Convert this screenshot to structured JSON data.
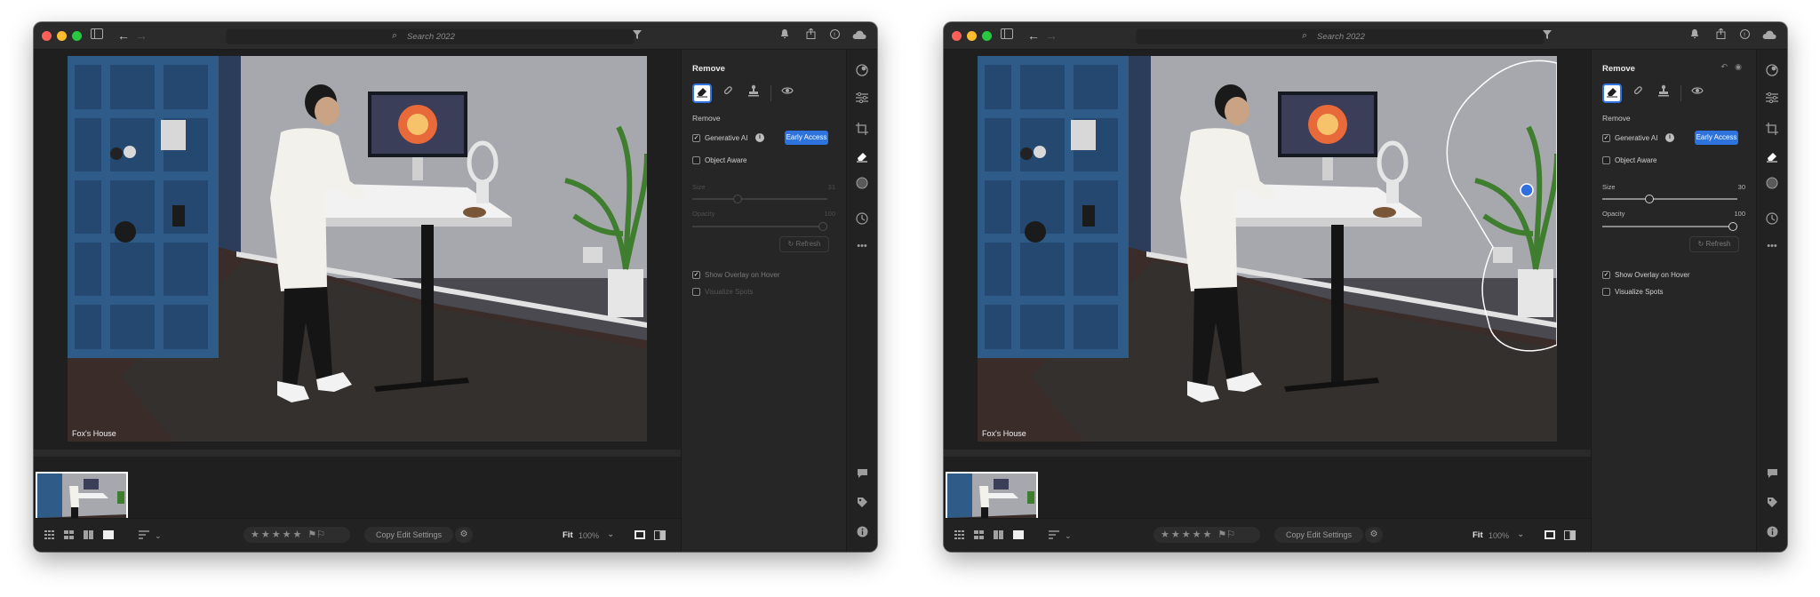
{
  "windows": [
    {
      "search_placeholder": "Search 2022",
      "photo_caption": "Fox's House",
      "panel": {
        "title": "Remove",
        "section_label": "Remove",
        "generative_ai_label": "Generative AI",
        "early_access_label": "Early Access",
        "object_aware_label": "Object Aware",
        "size_label": "Size",
        "size_value": "31",
        "opacity_label": "Opacity",
        "opacity_value": "100",
        "refresh_label": "Refresh",
        "show_overlay_label": "Show Overlay on Hover",
        "visualize_spots_label": "Visualize Spots",
        "controls_enabled": false
      },
      "bottombar": {
        "copy_label": "Copy Edit Settings",
        "fit_label": "Fit",
        "zoom_value": "100%"
      }
    },
    {
      "search_placeholder": "Search 2022",
      "photo_caption": "Fox's House",
      "panel": {
        "title": "Remove",
        "section_label": "Remove",
        "generative_ai_label": "Generative AI",
        "early_access_label": "Early Access",
        "object_aware_label": "Object Aware",
        "size_label": "Size",
        "size_value": "30",
        "opacity_label": "Opacity",
        "opacity_value": "100",
        "refresh_label": "Refresh",
        "show_overlay_label": "Show Overlay on Hover",
        "visualize_spots_label": "Visualize Spots",
        "controls_enabled": true
      },
      "bottombar": {
        "copy_label": "Copy Edit Settings",
        "fit_label": "Fit",
        "zoom_value": "100%"
      }
    }
  ],
  "colors": {
    "accent_blue": "#2e73dd",
    "window_bg": "#1e1e1e",
    "panel_bg": "#262626"
  },
  "icons": {
    "tools": [
      "eraser-icon",
      "healing-brush-icon",
      "clone-stamp-icon",
      "red-eye-icon"
    ],
    "rail": [
      "presets-icon",
      "edit-sliders-icon",
      "crop-icon",
      "remove-icon",
      "masking-icon",
      "history-icon",
      "more-icon",
      "comment-icon",
      "tag-icon",
      "info-icon"
    ]
  }
}
